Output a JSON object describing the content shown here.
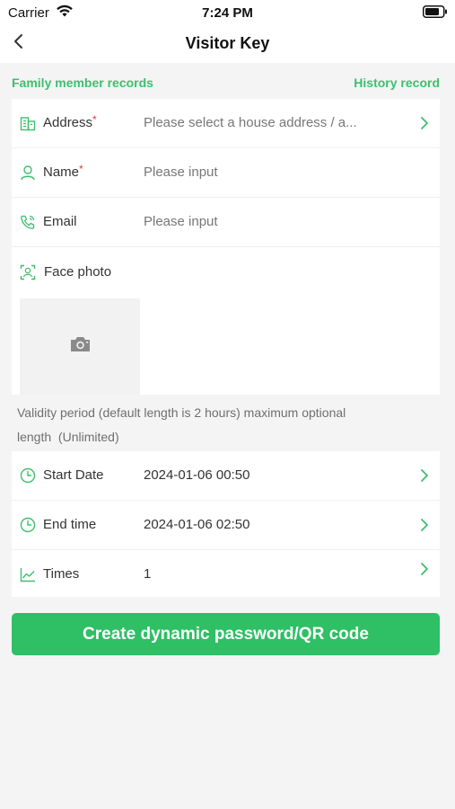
{
  "status_bar": {
    "carrier": "Carrier",
    "time": "7:24 PM"
  },
  "nav": {
    "title": "Visitor Key",
    "back_icon": "chevron-left-icon"
  },
  "links": {
    "family": "Family member records",
    "history": "History record"
  },
  "form": {
    "address": {
      "label": "Address",
      "required_mark": "*",
      "placeholder": "Please select a house address / a...",
      "icon": "building-icon"
    },
    "name": {
      "label": "Name",
      "required_mark": "*",
      "placeholder": "Please input",
      "icon": "person-icon"
    },
    "email": {
      "label": "Email",
      "placeholder": "Please input",
      "icon": "phone-icon"
    },
    "face_photo": {
      "label": "Face photo",
      "icon": "face-scan-icon",
      "upload_icon": "camera-icon"
    }
  },
  "validity_note": "Validity period (default length is 2 hours) maximum optional length  (Unlimited)",
  "time_settings": {
    "start": {
      "label": "Start Date",
      "value": "2024-01-06 00:50",
      "icon": "clock-icon"
    },
    "end": {
      "label": "End time",
      "value": "2024-01-06 02:50",
      "icon": "clock-icon"
    },
    "times": {
      "label": "Times",
      "value": "1",
      "icon": "line-chart-icon"
    }
  },
  "submit_label": "Create dynamic password/QR code",
  "colors": {
    "accent": "#2fbf65",
    "link": "#3dbf6e",
    "required": "#e53935",
    "background": "#f4f4f4"
  }
}
